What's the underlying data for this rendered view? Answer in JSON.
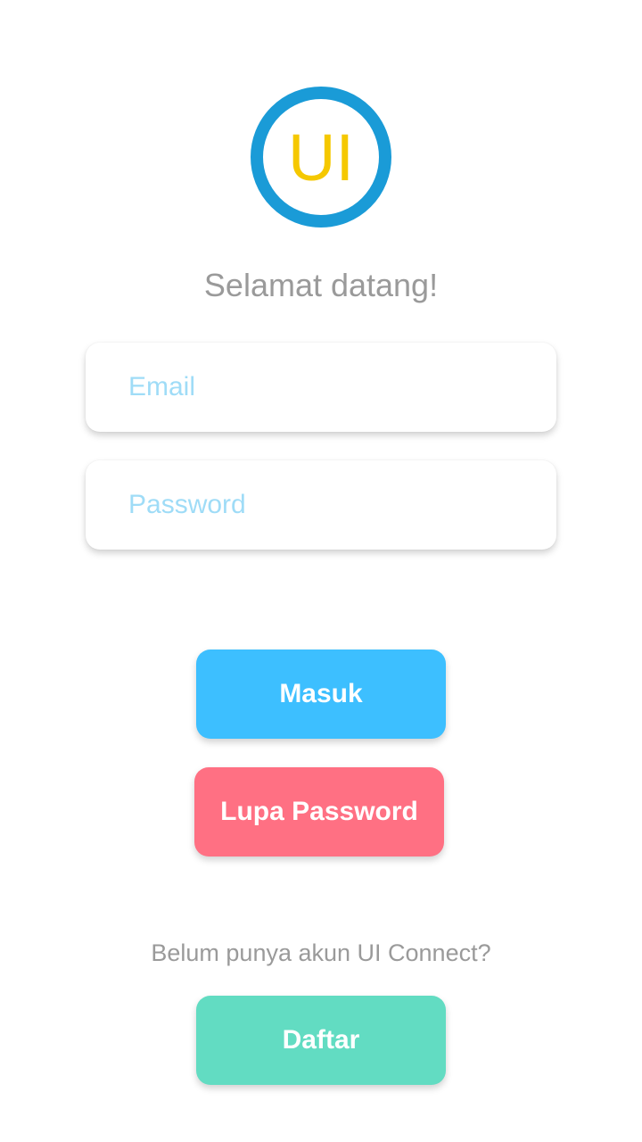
{
  "logo": {
    "text": "UI",
    "ring_color": "#1a9bd7",
    "text_color": "#f5c800"
  },
  "welcome_text": "Selamat datang!",
  "form": {
    "email_placeholder": "Email",
    "email_value": "",
    "password_placeholder": "Password",
    "password_value": ""
  },
  "buttons": {
    "login_label": "Masuk",
    "forgot_label": "Lupa Password",
    "register_label": "Daftar"
  },
  "register_prompt": "Belum punya akun UI Connect?",
  "colors": {
    "login": "#3dbfff",
    "forgot": "#ff7083",
    "register": "#62dcc2",
    "placeholder": "#9fdcf7"
  }
}
